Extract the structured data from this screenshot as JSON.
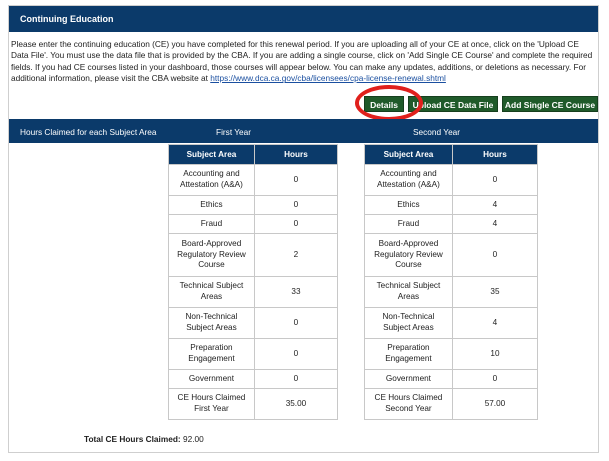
{
  "header": {
    "title": "Continuing Education"
  },
  "instructions": {
    "text": "Please enter the continuing education (CE) you have completed for this renewal period.  If you are uploading all of your CE at once, click on the 'Upload CE Data File'.  You must use the data file that is provided by the CBA.  If you are adding a single course, click on 'Add Single CE Course' and complete the required fields.  If you had CE courses listed in your dashboard, those courses will appear below.  You can make any updates, additions, or deletions as necessary.  For additional information, please visit the CBA website at ",
    "link": "https://www.dca.ca.gov/cba/licensees/cpa-license-renewal.shtml"
  },
  "buttons": {
    "details": "Details",
    "upload": "Upload CE Data File",
    "add_single": "Add Single CE Course"
  },
  "section_bar": {
    "label": "Hours Claimed for each Subject Area",
    "first_year": "First Year",
    "second_year": "Second Year"
  },
  "table": {
    "col_subject": "Subject Area",
    "col_hours": "Hours"
  },
  "first_year_rows": [
    {
      "subject": "Accounting and Attestation (A&A)",
      "hours": "0"
    },
    {
      "subject": "Ethics",
      "hours": "0"
    },
    {
      "subject": "Fraud",
      "hours": "0"
    },
    {
      "subject": "Board-Approved Regulatory Review Course",
      "hours": "2"
    },
    {
      "subject": "Technical Subject Areas",
      "hours": "33"
    },
    {
      "subject": "Non-Technical Subject Areas",
      "hours": "0"
    },
    {
      "subject": "Preparation Engagement",
      "hours": "0"
    },
    {
      "subject": "Government",
      "hours": "0"
    },
    {
      "subject": "CE Hours Claimed First Year",
      "hours": "35.00"
    }
  ],
  "second_year_rows": [
    {
      "subject": "Accounting and Attestation (A&A)",
      "hours": "0"
    },
    {
      "subject": "Ethics",
      "hours": "4"
    },
    {
      "subject": "Fraud",
      "hours": "4"
    },
    {
      "subject": "Board-Approved Regulatory Review Course",
      "hours": "0"
    },
    {
      "subject": "Technical Subject Areas",
      "hours": "35"
    },
    {
      "subject": "Non-Technical Subject Areas",
      "hours": "4"
    },
    {
      "subject": "Preparation Engagement",
      "hours": "10"
    },
    {
      "subject": "Government",
      "hours": "0"
    },
    {
      "subject": "CE Hours Claimed Second Year",
      "hours": "57.00"
    }
  ],
  "total": {
    "label": "Total CE Hours Claimed:",
    "value": "92.00"
  },
  "colors": {
    "header_blue": "#0b3a6a",
    "button_green": "#1f5a2a",
    "highlight_red": "#e0201c"
  }
}
